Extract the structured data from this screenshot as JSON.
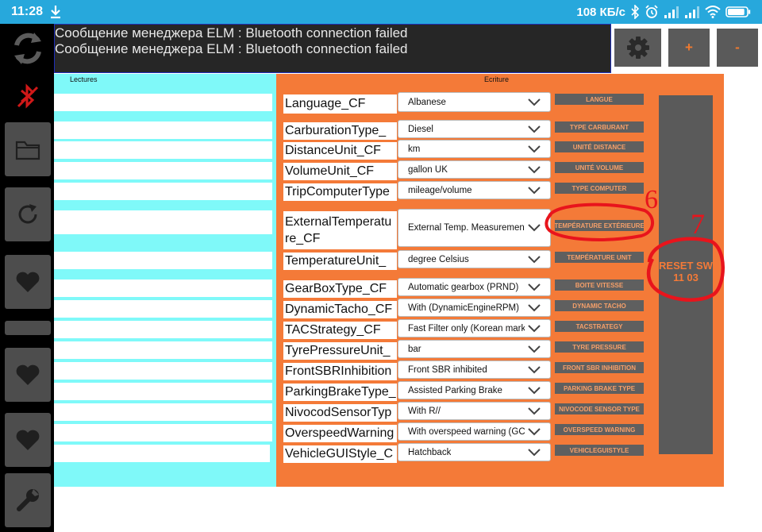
{
  "status_bar": {
    "time": "11:28",
    "network_speed": "108 КБ/с",
    "battery_level": 0.9
  },
  "messages": [
    "Сообщение менеджера ELM : Bluetooth connection failed",
    "Сообщение менеджера ELM : Bluetooth connection failed"
  ],
  "toolbar": {
    "plus_label": "+",
    "minus_label": "-"
  },
  "lectures": {
    "title": "Lectures"
  },
  "ecriture": {
    "title": "Ecriture"
  },
  "params": [
    {
      "name": "Language_CF",
      "value": "Albanese",
      "button": "LANGUE"
    },
    {
      "name": "CarburationType_",
      "value": "Diesel",
      "button": "TYPE CARBURANT"
    },
    {
      "name": "DistanceUnit_CF",
      "value": "km",
      "button": "UNITÉ DISTANCE"
    },
    {
      "name": "VolumeUnit_CF",
      "value": "gallon UK",
      "button": "UNITÉ VOLUME"
    },
    {
      "name": "TripComputerType",
      "value": "mileage/volume",
      "button": "TYPE COMPUTER"
    },
    {
      "name": "ExternalTemperature_CF",
      "value": "External Temp. Measurement a...",
      "button": "TEMPÉRATURE EXTÉRIEURE"
    },
    {
      "name": "TemperatureUnit_",
      "value": "degree Celsius",
      "button": "TEMPÉRATURE UNIT"
    },
    {
      "name": "GearBoxType_CF",
      "value": "Automatic gearbox (PRND)",
      "button": "BOITE VITESSE"
    },
    {
      "name": "DynamicTacho_CF",
      "value": "With (DynamicEngineRPM)",
      "button": "DYNAMIC TACHO"
    },
    {
      "name": "TACStrategy_CF",
      "value": "Fast Filter only (Korean market)",
      "button": "TACSTRATEGY"
    },
    {
      "name": "TyrePressureUnit_",
      "value": "bar",
      "button": "TYRE PRESSURE"
    },
    {
      "name": "FrontSBRInhibition",
      "value": "Front SBR inhibited",
      "button": "FRONT SBR INHIBITION"
    },
    {
      "name": "ParkingBrakeType_",
      "value": "Assisted Parking Brake",
      "button": "PARKING BRAKE TYPE"
    },
    {
      "name": "NivocodSensorTyp",
      "value": "With R//",
      "button": "NIVOCODE SENSOR TYPE"
    },
    {
      "name": "OverspeedWarning",
      "value": "With overspeed warning (GCC...",
      "button": "OVERSPEED WARNING"
    },
    {
      "name": "VehicleGUIStyle_C",
      "value": "Hatchback",
      "button": "VEHICLEGUISTYLE"
    }
  ],
  "reset_button": {
    "line1": "RESET SW",
    "line2": "11 03"
  },
  "annotations": {
    "label_6": "6",
    "label_7": "7",
    "color": "#e8141c"
  },
  "icons": {
    "sync": "sync-icon",
    "bluetooth_off": "bluetooth-off-icon",
    "folder": "folder-icon",
    "refresh": "refresh-icon",
    "heart": "heart-icon",
    "wrench": "wrench-icon",
    "gear": "gear-icon",
    "download": "download-icon"
  },
  "colors": {
    "status_bar": "#27a8dc",
    "lectures_bg": "#7ff9f9",
    "ecriture_bg": "#f47a38",
    "button_bg": "#5f5f5f",
    "button_text": "#f6a06a"
  }
}
